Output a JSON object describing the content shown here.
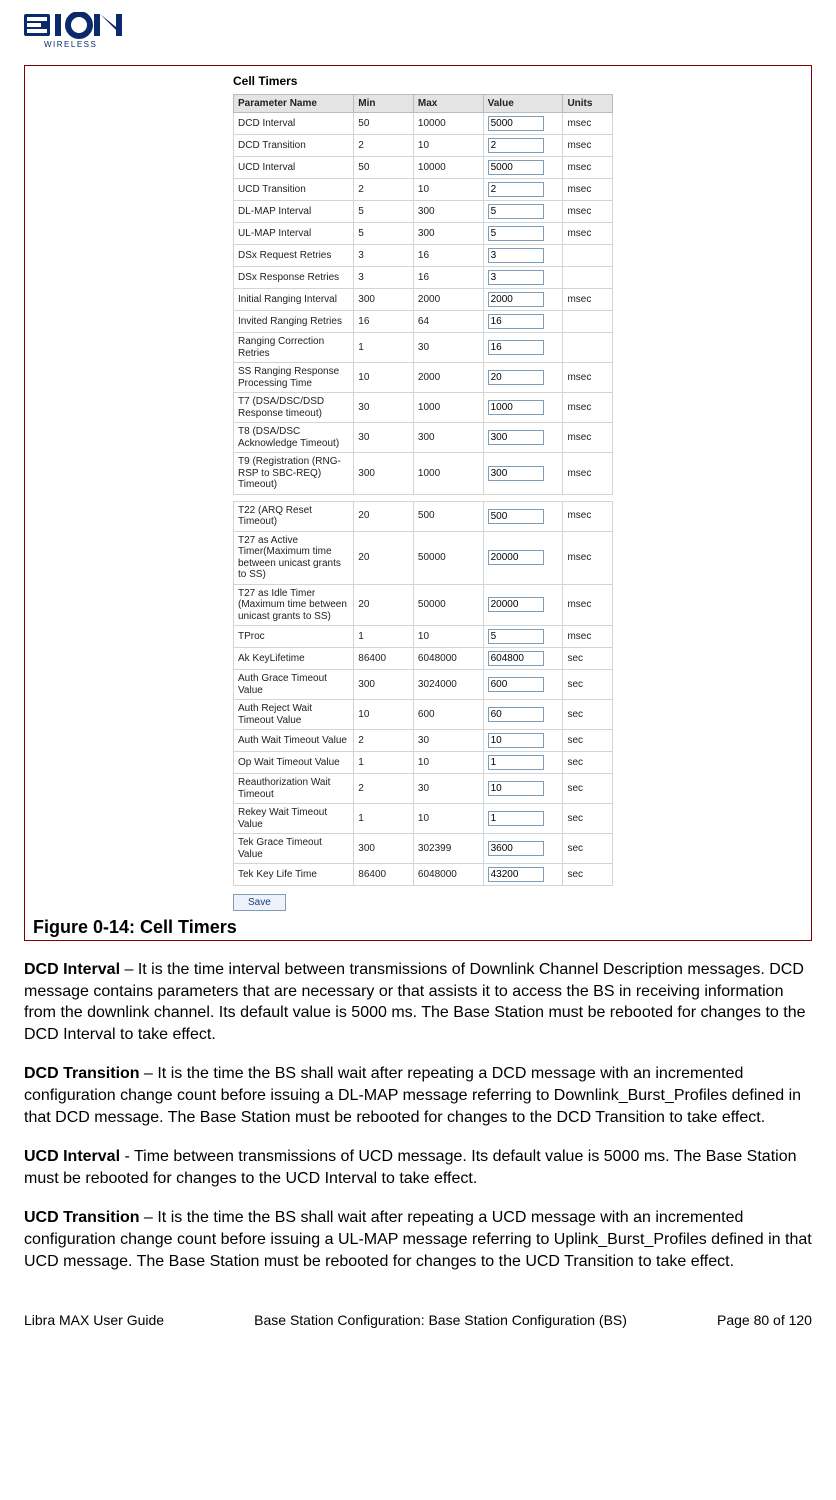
{
  "logo": {
    "brand": "EION",
    "sub": "WIRELESS"
  },
  "screenshot": {
    "title": "Cell Timers",
    "headers": [
      "Parameter Name",
      "Min",
      "Max",
      "Value",
      "Units"
    ],
    "rows1": [
      {
        "name": "DCD Interval",
        "min": "50",
        "max": "10000",
        "value": "5000",
        "units": "msec"
      },
      {
        "name": "DCD Transition",
        "min": "2",
        "max": "10",
        "value": "2",
        "units": "msec"
      },
      {
        "name": "UCD Interval",
        "min": "50",
        "max": "10000",
        "value": "5000",
        "units": "msec"
      },
      {
        "name": "UCD Transition",
        "min": "2",
        "max": "10",
        "value": "2",
        "units": "msec"
      },
      {
        "name": "DL-MAP Interval",
        "min": "5",
        "max": "300",
        "value": "5",
        "units": "msec"
      },
      {
        "name": "UL-MAP Interval",
        "min": "5",
        "max": "300",
        "value": "5",
        "units": "msec"
      },
      {
        "name": "DSx Request Retries",
        "min": "3",
        "max": "16",
        "value": "3",
        "units": ""
      },
      {
        "name": "DSx Response Retries",
        "min": "3",
        "max": "16",
        "value": "3",
        "units": ""
      },
      {
        "name": "Initial Ranging Interval",
        "min": "300",
        "max": "2000",
        "value": "2000",
        "units": "msec"
      },
      {
        "name": "Invited Ranging Retries",
        "min": "16",
        "max": "64",
        "value": "16",
        "units": ""
      },
      {
        "name": "Ranging Correction Retries",
        "min": "1",
        "max": "30",
        "value": "16",
        "units": ""
      },
      {
        "name": "SS Ranging Response Processing Time",
        "min": "10",
        "max": "2000",
        "value": "20",
        "units": "msec"
      },
      {
        "name": "T7 (DSA/DSC/DSD Response timeout)",
        "min": "30",
        "max": "1000",
        "value": "1000",
        "units": "msec"
      },
      {
        "name": "T8 (DSA/DSC Acknowledge Timeout)",
        "min": "30",
        "max": "300",
        "value": "300",
        "units": "msec"
      },
      {
        "name": "T9 (Registration (RNG-RSP to SBC-REQ) Timeout)",
        "min": "300",
        "max": "1000",
        "value": "300",
        "units": "msec"
      }
    ],
    "rows2": [
      {
        "name": "T22 (ARQ Reset Timeout)",
        "min": "20",
        "max": "500",
        "value": "500",
        "units": "msec"
      },
      {
        "name": "T27 as Active Timer(Maximum time between unicast grants to SS)",
        "min": "20",
        "max": "50000",
        "value": "20000",
        "units": "msec"
      },
      {
        "name": "T27 as Idle Timer (Maximum time between unicast grants to SS)",
        "min": "20",
        "max": "50000",
        "value": "20000",
        "units": "msec"
      },
      {
        "name": "TProc",
        "min": "1",
        "max": "10",
        "value": "5",
        "units": "msec"
      },
      {
        "name": "Ak KeyLifetime",
        "min": "86400",
        "max": "6048000",
        "value": "604800",
        "units": "sec"
      },
      {
        "name": "Auth Grace Timeout Value",
        "min": "300",
        "max": "3024000",
        "value": "600",
        "units": "sec"
      },
      {
        "name": "Auth Reject Wait Timeout Value",
        "min": "10",
        "max": "600",
        "value": "60",
        "units": "sec"
      },
      {
        "name": "Auth Wait Timeout Value",
        "min": "2",
        "max": "30",
        "value": "10",
        "units": "sec"
      },
      {
        "name": "Op Wait Timeout Value",
        "min": "1",
        "max": "10",
        "value": "1",
        "units": "sec"
      },
      {
        "name": "Reauthorization Wait Timeout",
        "min": "2",
        "max": "30",
        "value": "10",
        "units": "sec"
      },
      {
        "name": "Rekey Wait Timeout Value",
        "min": "1",
        "max": "10",
        "value": "1",
        "units": "sec"
      },
      {
        "name": "Tek Grace Timeout Value",
        "min": "300",
        "max": "302399",
        "value": "3600",
        "units": "sec"
      },
      {
        "name": "Tek Key Life Time",
        "min": "86400",
        "max": "6048000",
        "value": "43200",
        "units": "sec"
      }
    ],
    "save_label": "Save"
  },
  "caption": "Figure 0-14: Cell Timers",
  "para1": {
    "term": "DCD Interval",
    "text": " – It is the time interval between transmissions of Downlink Channel Description messages. DCD message contains parameters that are necessary or that assists it to access the BS in receiving information from the downlink channel. Its default value is 5000 ms. The Base Station must be rebooted for changes to the DCD Interval to take effect."
  },
  "para2": {
    "term": "DCD Transition",
    "text": " – It is the time the BS shall wait after repeating a DCD message with an incremented configuration change count before issuing a DL-MAP message referring to  Downlink_Burst_Profiles defined in that DCD message. The Base Station must be rebooted for changes to the DCD Transition to take effect."
  },
  "para3": {
    "term": "UCD Interval",
    "text": " - Time between transmissions of UCD message. Its default value is 5000 ms. The Base Station must be rebooted for changes to the UCD Interval to take effect."
  },
  "para4": {
    "term": "UCD Transition",
    "text": " – It is the time the BS shall wait after repeating a UCD message with an incremented configuration change count before issuing a UL-MAP message referring to Uplink_Burst_Profiles defined in that UCD message. The Base Station must be rebooted for changes to the UCD Transition to take effect."
  },
  "footer": {
    "left": "Libra MAX User Guide",
    "center": "Base Station Configuration: Base Station Configuration (BS)",
    "right": "Page 80 of 120"
  }
}
